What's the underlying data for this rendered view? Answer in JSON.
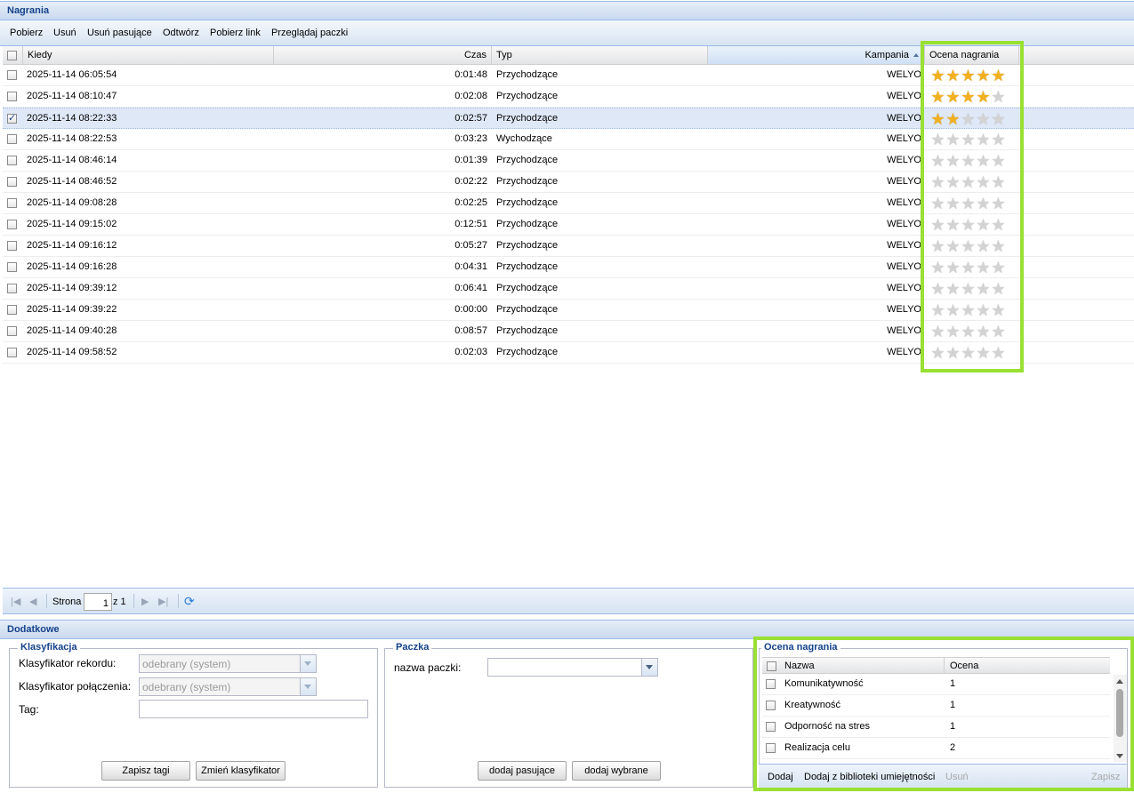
{
  "main_panel": {
    "title": "Nagrania"
  },
  "toolbar": [
    "Pobierz",
    "Usuń",
    "Usuń pasujące",
    "Odtwórz",
    "Pobierz link",
    "Przeglądaj paczki"
  ],
  "grid": {
    "columns": {
      "when": "Kiedy",
      "duration": "Czas",
      "type": "Typ",
      "campaign": "Kampania",
      "rating": "Ocena nagrania"
    },
    "campaign_sort_icon": "sort-asc-icon",
    "rows": [
      {
        "when": "2025-11-14 06:05:54",
        "duration": "0:01:48",
        "type": "Przychodzące",
        "campaign": "WELYO",
        "stars": 5,
        "checked": false
      },
      {
        "when": "2025-11-14 08:10:47",
        "duration": "0:02:08",
        "type": "Przychodzące",
        "campaign": "WELYO",
        "stars": 4,
        "checked": false
      },
      {
        "when": "2025-11-14 08:22:33",
        "duration": "0:02:57",
        "type": "Przychodzące",
        "campaign": "WELYO",
        "stars": 2,
        "checked": true
      },
      {
        "when": "2025-11-14 08:22:53",
        "duration": "0:03:23",
        "type": "Wychodzące",
        "campaign": "WELYO",
        "stars": 0,
        "checked": false
      },
      {
        "when": "2025-11-14 08:46:14",
        "duration": "0:01:39",
        "type": "Przychodzące",
        "campaign": "WELYO",
        "stars": 0,
        "checked": false
      },
      {
        "when": "2025-11-14 08:46:52",
        "duration": "0:02:22",
        "type": "Przychodzące",
        "campaign": "WELYO",
        "stars": 0,
        "checked": false
      },
      {
        "when": "2025-11-14 09:08:28",
        "duration": "0:02:25",
        "type": "Przychodzące",
        "campaign": "WELYO",
        "stars": 0,
        "checked": false
      },
      {
        "when": "2025-11-14 09:15:02",
        "duration": "0:12:51",
        "type": "Przychodzące",
        "campaign": "WELYO",
        "stars": 0,
        "checked": false
      },
      {
        "when": "2025-11-14 09:16:12",
        "duration": "0:05:27",
        "type": "Przychodzące",
        "campaign": "WELYO",
        "stars": 0,
        "checked": false
      },
      {
        "when": "2025-11-14 09:16:28",
        "duration": "0:04:31",
        "type": "Przychodzące",
        "campaign": "WELYO",
        "stars": 0,
        "checked": false
      },
      {
        "when": "2025-11-14 09:39:12",
        "duration": "0:06:41",
        "type": "Przychodzące",
        "campaign": "WELYO",
        "stars": 0,
        "checked": false
      },
      {
        "when": "2025-11-14 09:39:22",
        "duration": "0:00:00",
        "type": "Przychodzące",
        "campaign": "WELYO",
        "stars": 0,
        "checked": false
      },
      {
        "when": "2025-11-14 09:40:28",
        "duration": "0:08:57",
        "type": "Przychodzące",
        "campaign": "WELYO",
        "stars": 0,
        "checked": false
      },
      {
        "when": "2025-11-14 09:58:52",
        "duration": "0:02:03",
        "type": "Przychodzące",
        "campaign": "WELYO",
        "stars": 0,
        "checked": false
      }
    ],
    "max_stars": 5
  },
  "pager": {
    "page_label": "Strona",
    "page_value": "1",
    "of_label": "z 1"
  },
  "extra_panel": {
    "title": "Dodatkowe"
  },
  "classification": {
    "legend": "Klasyfikacja",
    "record_label": "Klasyfikator rekordu:",
    "record_value": "odebrany (system)",
    "call_label": "Klasyfikator połączenia:",
    "call_value": "odebrany (system)",
    "tag_label": "Tag:",
    "tag_value": "",
    "save_tags": "Zapisz tagi",
    "change_classifier": "Zmień klasyfikator"
  },
  "package": {
    "legend": "Paczka",
    "name_label": "nazwa paczki:",
    "name_value": "",
    "add_matching": "dodaj pasujące",
    "add_selected": "dodaj wybrane"
  },
  "rating_panel": {
    "legend": "Ocena nagrania",
    "columns": {
      "name": "Nazwa",
      "score": "Ocena"
    },
    "rows": [
      {
        "name": "Komunikatywność",
        "score": "1"
      },
      {
        "name": "Kreatywność",
        "score": "1"
      },
      {
        "name": "Odporność na stres",
        "score": "1"
      },
      {
        "name": "Realizacja celu",
        "score": "2"
      }
    ],
    "toolbar": {
      "add": "Dodaj",
      "add_from_library": "Dodaj z biblioteki umiejętności",
      "remove": "Usuń",
      "save": "Zapisz"
    }
  },
  "colors": {
    "highlight": "#99e033",
    "header_text": "#15428b",
    "star_on": "#f2b01e",
    "star_off": "#d3d3d3",
    "selected_row": "#dfe8f6"
  }
}
